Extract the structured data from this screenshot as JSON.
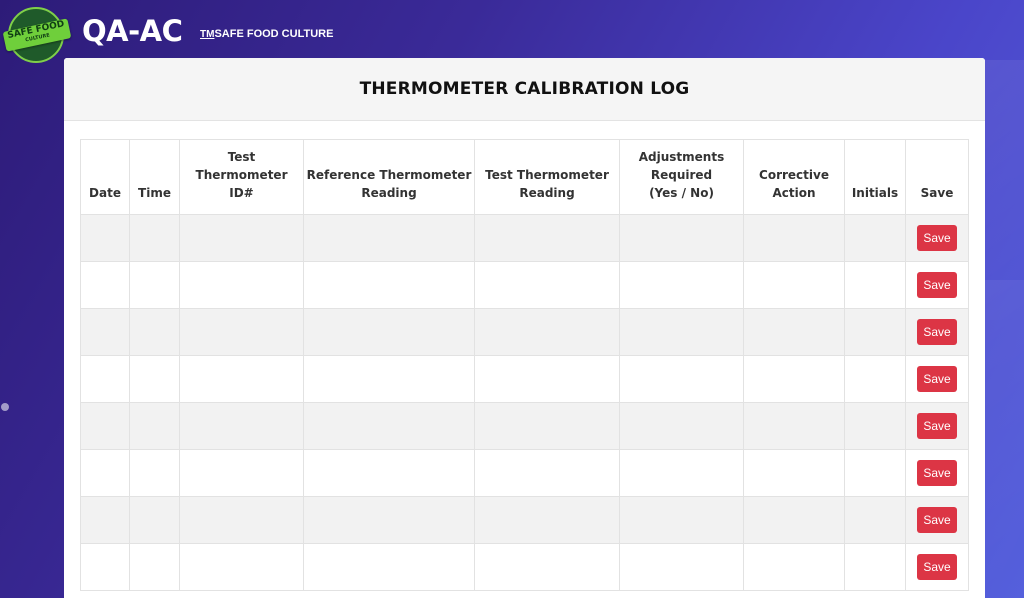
{
  "header": {
    "logo_text": "SAFE FOOD",
    "logo_subtext": "CULTURE",
    "brand": "QA-AC",
    "tagline_tm": "TM",
    "tagline": "SAFE FOOD CULTURE"
  },
  "page": {
    "title": "THERMOMETER CALIBRATION LOG"
  },
  "table": {
    "columns": [
      "Date",
      "Time",
      "Test\nThermometer\nID#",
      "Reference Thermometer\nReading",
      "Test Thermometer\nReading",
      "Adjustments\nRequired\n(Yes / No)",
      "Corrective\nAction",
      "Initials",
      "Save"
    ],
    "save_label": "Save",
    "row_count": 8
  },
  "colors": {
    "save_button": "#dc3545",
    "background_start": "#2d1b78",
    "background_end": "#5560dc",
    "logo_green": "#6fcf3b"
  }
}
